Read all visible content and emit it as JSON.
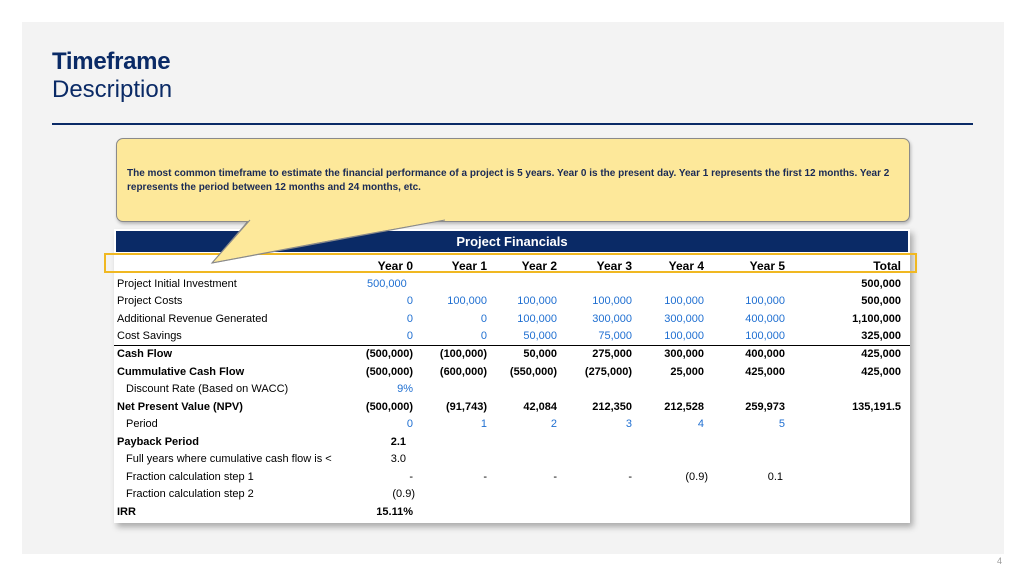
{
  "slide": {
    "title": "Timeframe",
    "subtitle": "Description",
    "page_number": "4"
  },
  "callout": {
    "text": "The most common timeframe to estimate the financial performance of a project is 5 years. Year 0 is the present day. Year 1 represents the first 12 months. Year 2 represents the period between 12 months and 24 months, etc."
  },
  "table": {
    "title": "Project Financials",
    "headers": [
      "Year 0",
      "Year 1",
      "Year 2",
      "Year 3",
      "Year 4",
      "Year 5",
      "Total"
    ],
    "rows": [
      {
        "label": "Project Initial Investment",
        "cells": [
          "500,000",
          "",
          "",
          "",
          "",
          "",
          "500,000"
        ]
      },
      {
        "label": "Project Costs",
        "cells": [
          "0",
          "100,000",
          "100,000",
          "100,000",
          "100,000",
          "100,000",
          "500,000"
        ]
      },
      {
        "label": "Additional Revenue Generated",
        "cells": [
          "0",
          "0",
          "100,000",
          "300,000",
          "300,000",
          "400,000",
          "1,100,000"
        ]
      },
      {
        "label": "Cost Savings",
        "cells": [
          "0",
          "0",
          "50,000",
          "75,000",
          "100,000",
          "100,000",
          "325,000"
        ]
      },
      {
        "label": "Cash Flow",
        "cells": [
          "(500,000)",
          "(100,000)",
          "50,000",
          "275,000",
          "300,000",
          "400,000",
          "425,000"
        ]
      },
      {
        "label": "Cummulative Cash Flow",
        "cells": [
          "(500,000)",
          "(600,000)",
          "(550,000)",
          "(275,000)",
          "25,000",
          "425,000",
          "425,000"
        ]
      },
      {
        "label": "Discount Rate (Based on WACC)",
        "cells": [
          "9%",
          "",
          "",
          "",
          "",
          "",
          ""
        ]
      },
      {
        "label": "Net Present Value (NPV)",
        "cells": [
          "(500,000)",
          "(91,743)",
          "42,084",
          "212,350",
          "212,528",
          "259,973",
          "135,191.5"
        ]
      },
      {
        "label": "Period",
        "cells": [
          "0",
          "1",
          "2",
          "3",
          "4",
          "5",
          ""
        ]
      },
      {
        "label": "Payback Period",
        "cells": [
          "2.1",
          "",
          "",
          "",
          "",
          "",
          ""
        ]
      },
      {
        "label": "Full years where cumulative cash flow is <",
        "cells": [
          "3.0",
          "",
          "",
          "",
          "",
          "",
          ""
        ]
      },
      {
        "label": "Fraction calculation step 1",
        "cells": [
          "-",
          "-",
          "-",
          "-",
          "(0.9)",
          "0.1",
          ""
        ]
      },
      {
        "label": "Fraction calculation step 2",
        "cells": [
          "(0.9)",
          "",
          "",
          "",
          "",
          "",
          ""
        ]
      },
      {
        "label": "IRR",
        "cells": [
          "15.11%",
          "",
          "",
          "",
          "",
          "",
          ""
        ]
      }
    ]
  },
  "colors": {
    "navy": "#0a2a66",
    "callout_fill": "#fde89a",
    "highlight_border": "#f0b822",
    "input_blue": "#1f6fd1"
  }
}
